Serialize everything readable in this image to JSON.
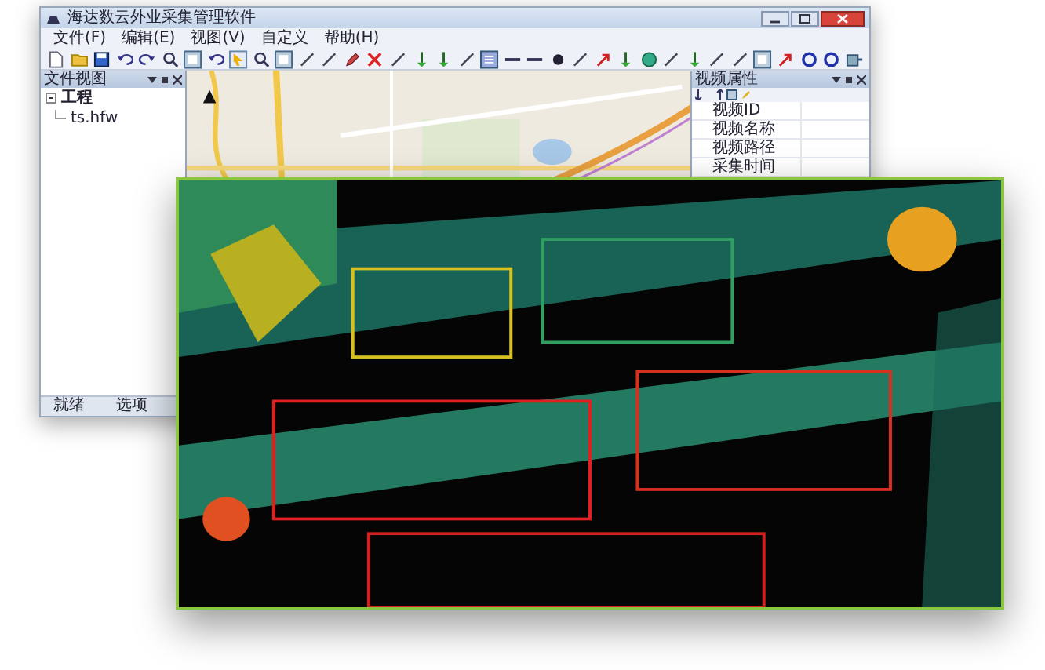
{
  "window": {
    "title": "海达数云外业采集管理软件"
  },
  "menu": [
    {
      "label": "文件(F)"
    },
    {
      "label": "编辑(E)"
    },
    {
      "label": "视图(V)"
    },
    {
      "label": "自定义"
    },
    {
      "label": "帮助(H)"
    }
  ],
  "left_panel": {
    "title": "文件视图",
    "tree": [
      {
        "label": "工程",
        "expanded": true,
        "children": [
          {
            "label": "ts.hfw"
          }
        ]
      }
    ]
  },
  "map": {
    "kind": "picture"
  },
  "right_panel": {
    "title": "视频属性",
    "properties": [
      "视频ID",
      "视频名称",
      "视频路径",
      "采集时间"
    ]
  },
  "status_bar": [
    "就绪",
    "选项"
  ],
  "overlay": {
    "kind": "picture"
  }
}
